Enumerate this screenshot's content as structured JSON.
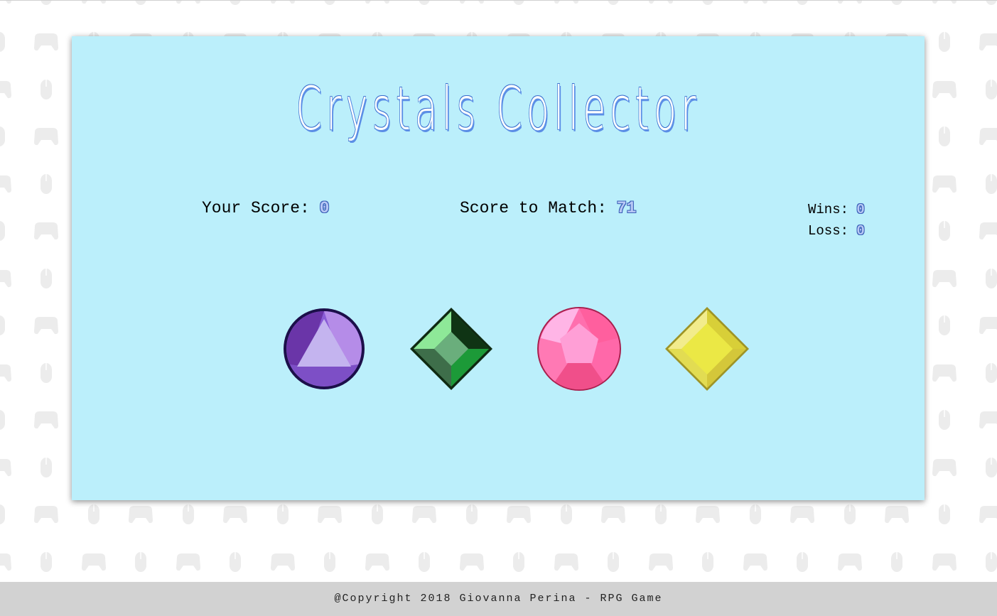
{
  "title": "Crystals Collector",
  "scoreboard": {
    "your_score_label": "Your Score:",
    "your_score": "0",
    "target_label": "Score to Match:",
    "target_score": "71",
    "wins_label": "Wins:",
    "wins": "0",
    "losses_label": "Loss:",
    "losses": "0"
  },
  "crystals": [
    {
      "name": "purple-crystal",
      "color": "#8a5cd6"
    },
    {
      "name": "green-crystal",
      "color": "#3aa25a"
    },
    {
      "name": "pink-crystal",
      "color": "#ff6fae"
    },
    {
      "name": "yellow-crystal",
      "color": "#e8e048"
    }
  ],
  "footer": {
    "text": "@Copyright 2018 Giovanna Perina - RPG Game"
  },
  "colors": {
    "panel": "#bbeffb",
    "title_shadow": "#5b8ee6",
    "footer_bg": "#d2d2d2",
    "pattern_icon": "#ececec"
  },
  "background_icons": [
    "gamepad-icon",
    "mouse-icon"
  ]
}
